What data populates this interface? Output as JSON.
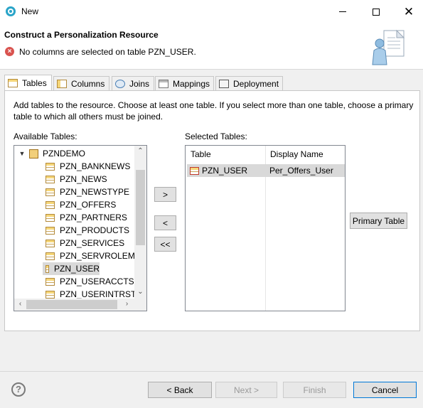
{
  "window": {
    "title": "New"
  },
  "header": {
    "title": "Construct a Personalization Resource",
    "message": "No columns are selected on table PZN_USER."
  },
  "tabs": [
    {
      "label": "Tables",
      "icon": "table-icon"
    },
    {
      "label": "Columns",
      "icon": "columns-icon"
    },
    {
      "label": "Joins",
      "icon": "joins-icon"
    },
    {
      "label": "Mappings",
      "icon": "mappings-icon"
    },
    {
      "label": "Deployment",
      "icon": "deployment-icon"
    }
  ],
  "tables_page": {
    "description": "Add tables to the resource.  Choose at least one table.  If you select more than one table, choose a primary table to which all others must be joined.",
    "available_label": "Available Tables:",
    "selected_label": "Selected Tables:",
    "tree": {
      "root": "PZNDEMO",
      "items": [
        "PZN_BANKNEWS",
        "PZN_NEWS",
        "PZN_NEWSTYPE",
        "PZN_OFFERS",
        "PZN_PARTNERS",
        "PZN_PRODUCTS",
        "PZN_SERVICES",
        "PZN_SERVROLEMAP",
        "PZN_USER",
        "PZN_USERACCTS",
        "PZN_USERINTRST"
      ],
      "selected": "PZN_USER"
    },
    "buttons": {
      "add": ">",
      "remove": "<",
      "remove_all": "<<",
      "primary": "Primary Table"
    },
    "selected_table": {
      "headers": [
        "Table",
        "Display Name"
      ],
      "rows": [
        {
          "table": "PZN_USER",
          "display_name": "Per_Offers_User"
        }
      ]
    }
  },
  "footer": {
    "back": "< Back",
    "next": "Next >",
    "finish": "Finish",
    "cancel": "Cancel"
  },
  "colors": {
    "error": "#d9534f",
    "selection": "#d9d9d9",
    "panel_border": "#c8c8c8"
  }
}
